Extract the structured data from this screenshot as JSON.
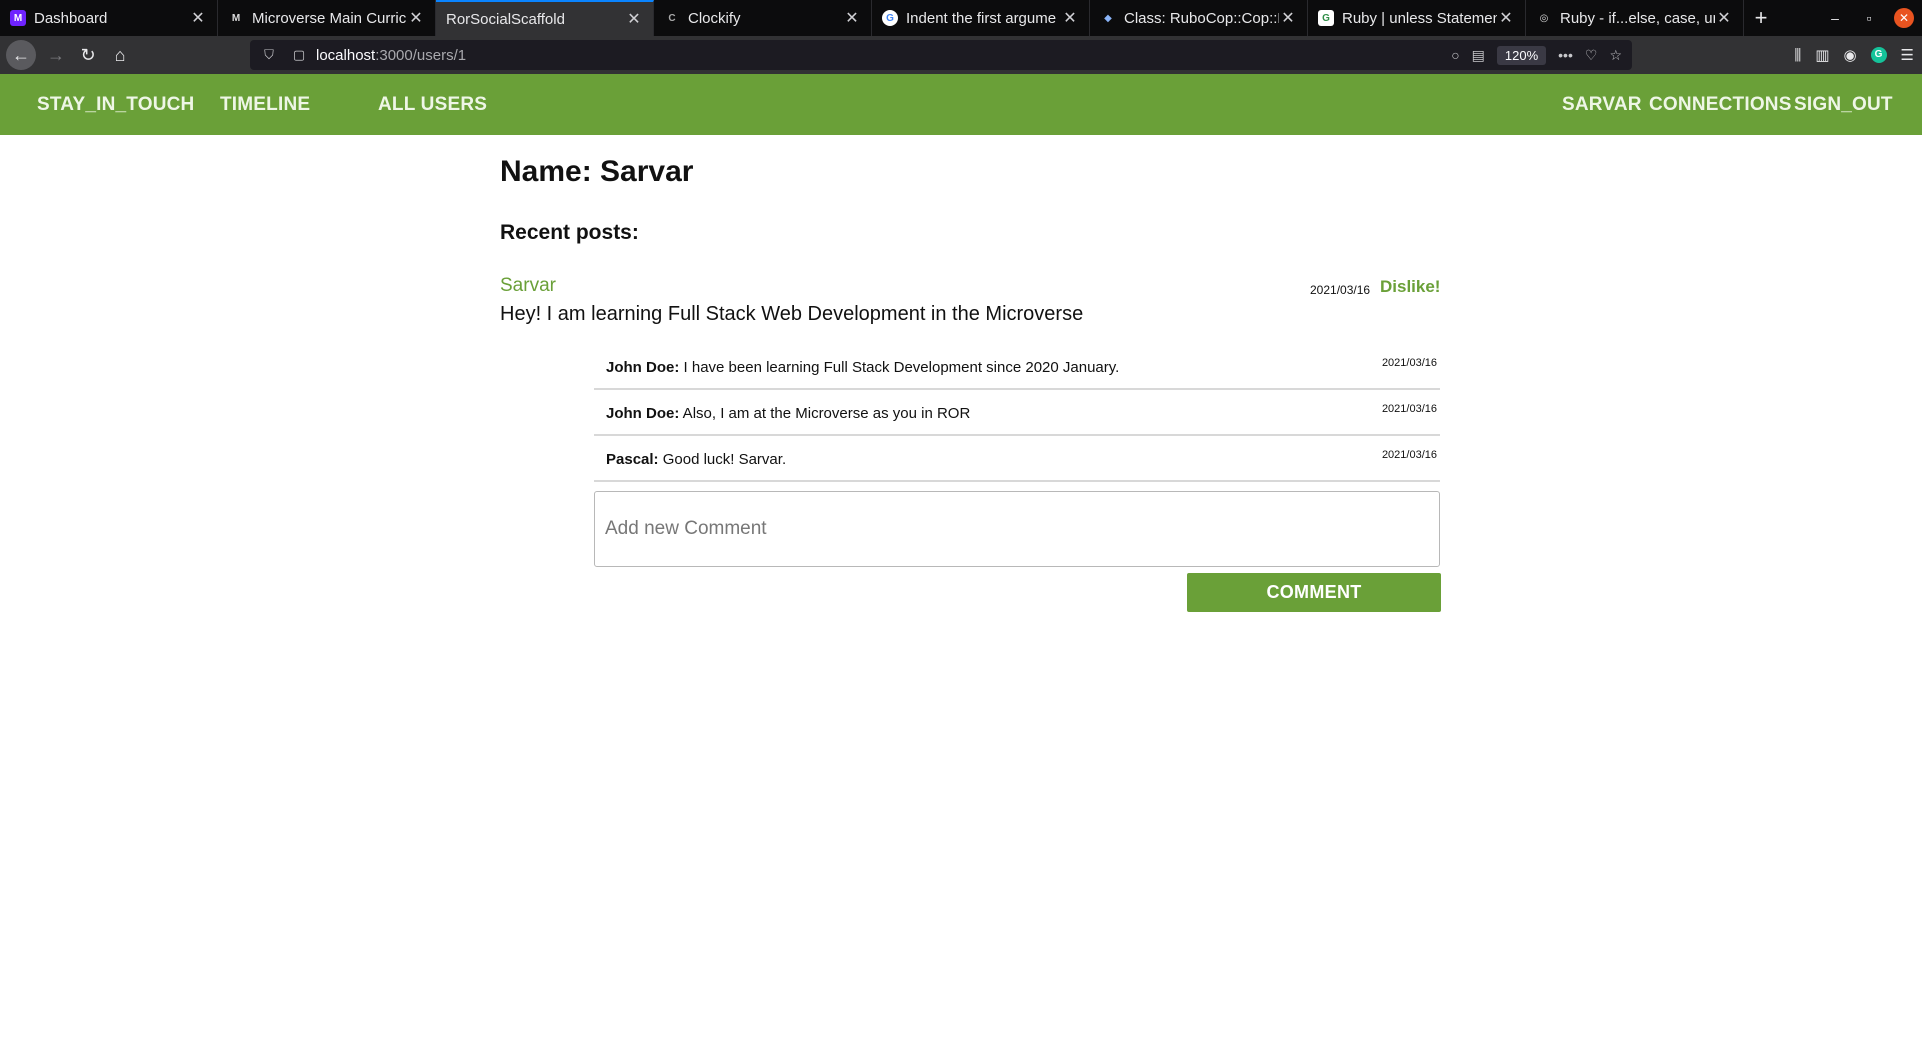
{
  "browser": {
    "tabs": [
      {
        "title": "Dashboard",
        "active": false
      },
      {
        "title": "Microverse Main Curricu",
        "active": false
      },
      {
        "title": "RorSocialScaffold",
        "active": true
      },
      {
        "title": "Clockify",
        "active": false
      },
      {
        "title": "Indent the first argume",
        "active": false
      },
      {
        "title": "Class: RuboCop::Cop::La",
        "active": false
      },
      {
        "title": "Ruby | unless Statement",
        "active": false
      },
      {
        "title": "Ruby - if...else, case, unl",
        "active": false
      }
    ],
    "url_host": "localhost",
    "url_path": ":3000/users/1",
    "zoom": "120%"
  },
  "nav": {
    "brand": "STAY_IN_TOUCH",
    "timeline": "TIMELINE",
    "all_users": "ALL USERS",
    "user": "SARVAR",
    "connections": "CONNECTIONS",
    "sign_out": "SIGN_OUT"
  },
  "profile": {
    "title": "Name: Sarvar",
    "recent_posts_heading": "Recent posts:"
  },
  "post": {
    "author": "Sarvar",
    "date": "2021/03/16",
    "dislike_label": "Dislike!",
    "content": "Hey! I am learning Full Stack Web Development in the Microverse"
  },
  "comments": [
    {
      "author": "John Doe:",
      "text": " I have been learning Full Stack Development since 2020 January.",
      "date": "2021/03/16"
    },
    {
      "author": "John Doe:",
      "text": " Also, I am at the Microverse as you in ROR",
      "date": "2021/03/16"
    },
    {
      "author": "Pascal:",
      "text": " Good luck! Sarvar.",
      "date": "2021/03/16"
    }
  ],
  "comment_form": {
    "placeholder": "Add new Comment",
    "button_label": "COMMENT"
  },
  "colors": {
    "brand_green": "#6aa038",
    "tab_accent": "#0a84ff"
  }
}
